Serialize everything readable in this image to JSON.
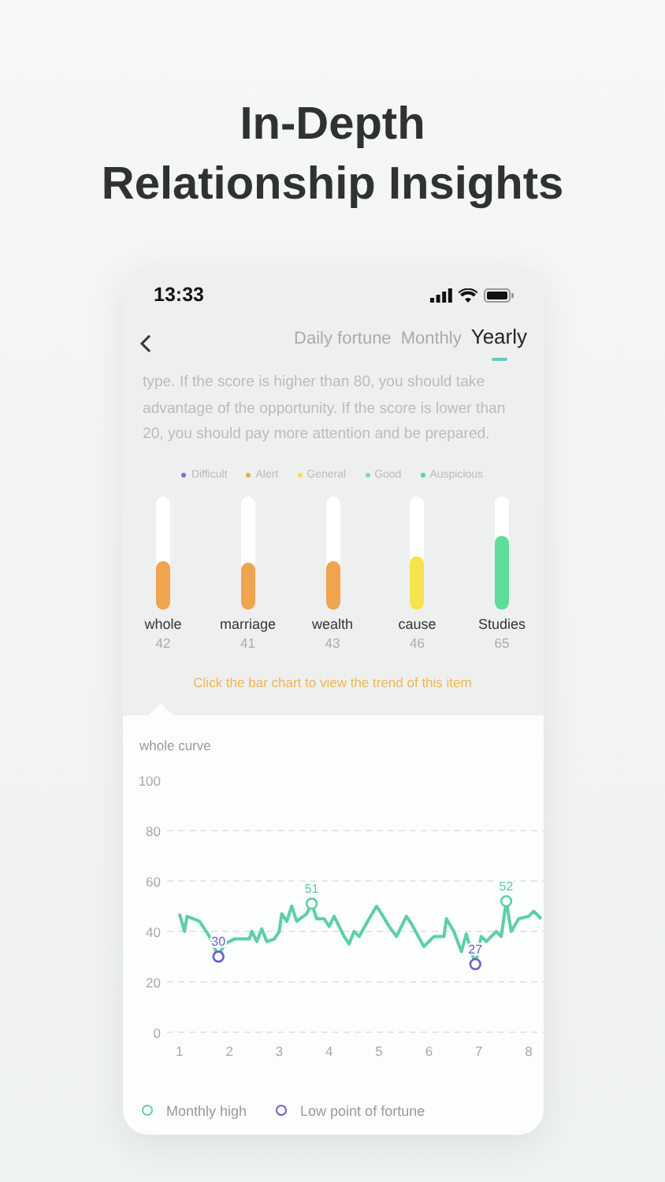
{
  "headline": [
    "In-Depth",
    "Relationship Insights"
  ],
  "status_bar": {
    "time": "13:33"
  },
  "tabs": [
    {
      "label": "Daily fortune",
      "selected": false
    },
    {
      "label": "Monthly",
      "selected": false
    },
    {
      "label": "Yearly",
      "selected": true
    }
  ],
  "description": "type. If the score is higher than 80, you should take advantage of the opportunity. If the score is lower than 20, you should pay more attention and be prepared.",
  "levels": [
    {
      "label": "Difficult",
      "color": "#7b6fd6"
    },
    {
      "label": "Alert",
      "color": "#f0a64c"
    },
    {
      "label": "General",
      "color": "#f5e04a"
    },
    {
      "label": "Good",
      "color": "#79d9cc"
    },
    {
      "label": "Auspicious",
      "color": "#5dd49a"
    }
  ],
  "bars": [
    {
      "label": "whole",
      "value": "42",
      "level": 0.42,
      "color": "#efa450"
    },
    {
      "label": "marriage",
      "value": "41",
      "level": 0.41,
      "color": "#efa450"
    },
    {
      "label": "wealth",
      "value": "43",
      "level": 0.43,
      "color": "#efa450"
    },
    {
      "label": "cause",
      "value": "46",
      "level": 0.46,
      "color": "#f8e34c"
    },
    {
      "label": "Studies",
      "value": "65",
      "level": 0.65,
      "color": "#5ddc9a"
    }
  ],
  "hint": "Click the bar chart to view the trend of this item",
  "curve": {
    "chart_data": {
      "type": "line",
      "title": "whole curve",
      "x": [
        1,
        1.1,
        1.15,
        1.4,
        1.6,
        1.78,
        1.9,
        2.1,
        2.4,
        2.45,
        2.55,
        2.65,
        2.75,
        2.9,
        3,
        3.05,
        3.15,
        3.25,
        3.35,
        3.55,
        3.65,
        3.75,
        3.9,
        4,
        4.1,
        4.3,
        4.4,
        4.5,
        4.6,
        4.8,
        4.95,
        5.05,
        5.2,
        5.35,
        5.55,
        5.65,
        5.9,
        6.1,
        6.3,
        6.35,
        6.5,
        6.65,
        6.75,
        6.93,
        7.05,
        7.15,
        7.35,
        7.45,
        7.55,
        7.65,
        7.8,
        8,
        8.1,
        8.25
      ],
      "series": [
        {
          "color": "#5ccfa8",
          "values": [
            47,
            40,
            46,
            44,
            38,
            30,
            35,
            37,
            37,
            40,
            36,
            41,
            36,
            37,
            40,
            47,
            44,
            50,
            44,
            47,
            51,
            45,
            45,
            42,
            46,
            38,
            35,
            40,
            38,
            45,
            50,
            47,
            42,
            38,
            46,
            43,
            34,
            38,
            38,
            45,
            40,
            32,
            39,
            27,
            38,
            36,
            40,
            38,
            52,
            40,
            45,
            46,
            48,
            45
          ]
        }
      ],
      "xlim": [
        0.75,
        8.3
      ],
      "ylim": [
        0,
        100
      ],
      "grid": true,
      "xticks": [
        1,
        2,
        3,
        4,
        5,
        6,
        7,
        8
      ],
      "yticks": [
        0,
        20,
        40,
        60,
        80,
        100
      ],
      "annotations": [
        {
          "x": 1.78,
          "y": 30,
          "text": "30"
        },
        {
          "x": 3.65,
          "y": 51,
          "text": "51"
        },
        {
          "x": 6.93,
          "y": 27,
          "text": "27"
        },
        {
          "x": 7.55,
          "y": 52,
          "text": "52"
        }
      ]
    },
    "markers": [
      {
        "color": "#6a5fcf"
      },
      {
        "color": "#5ccfa8"
      },
      {
        "color": "#6a5fcf"
      },
      {
        "color": "#5ccfa8"
      }
    ],
    "legend": [
      {
        "label": "Monthly high",
        "color": "#5ccfa8"
      },
      {
        "label": "Low point of fortune",
        "color": "#6a5fcf"
      }
    ]
  }
}
